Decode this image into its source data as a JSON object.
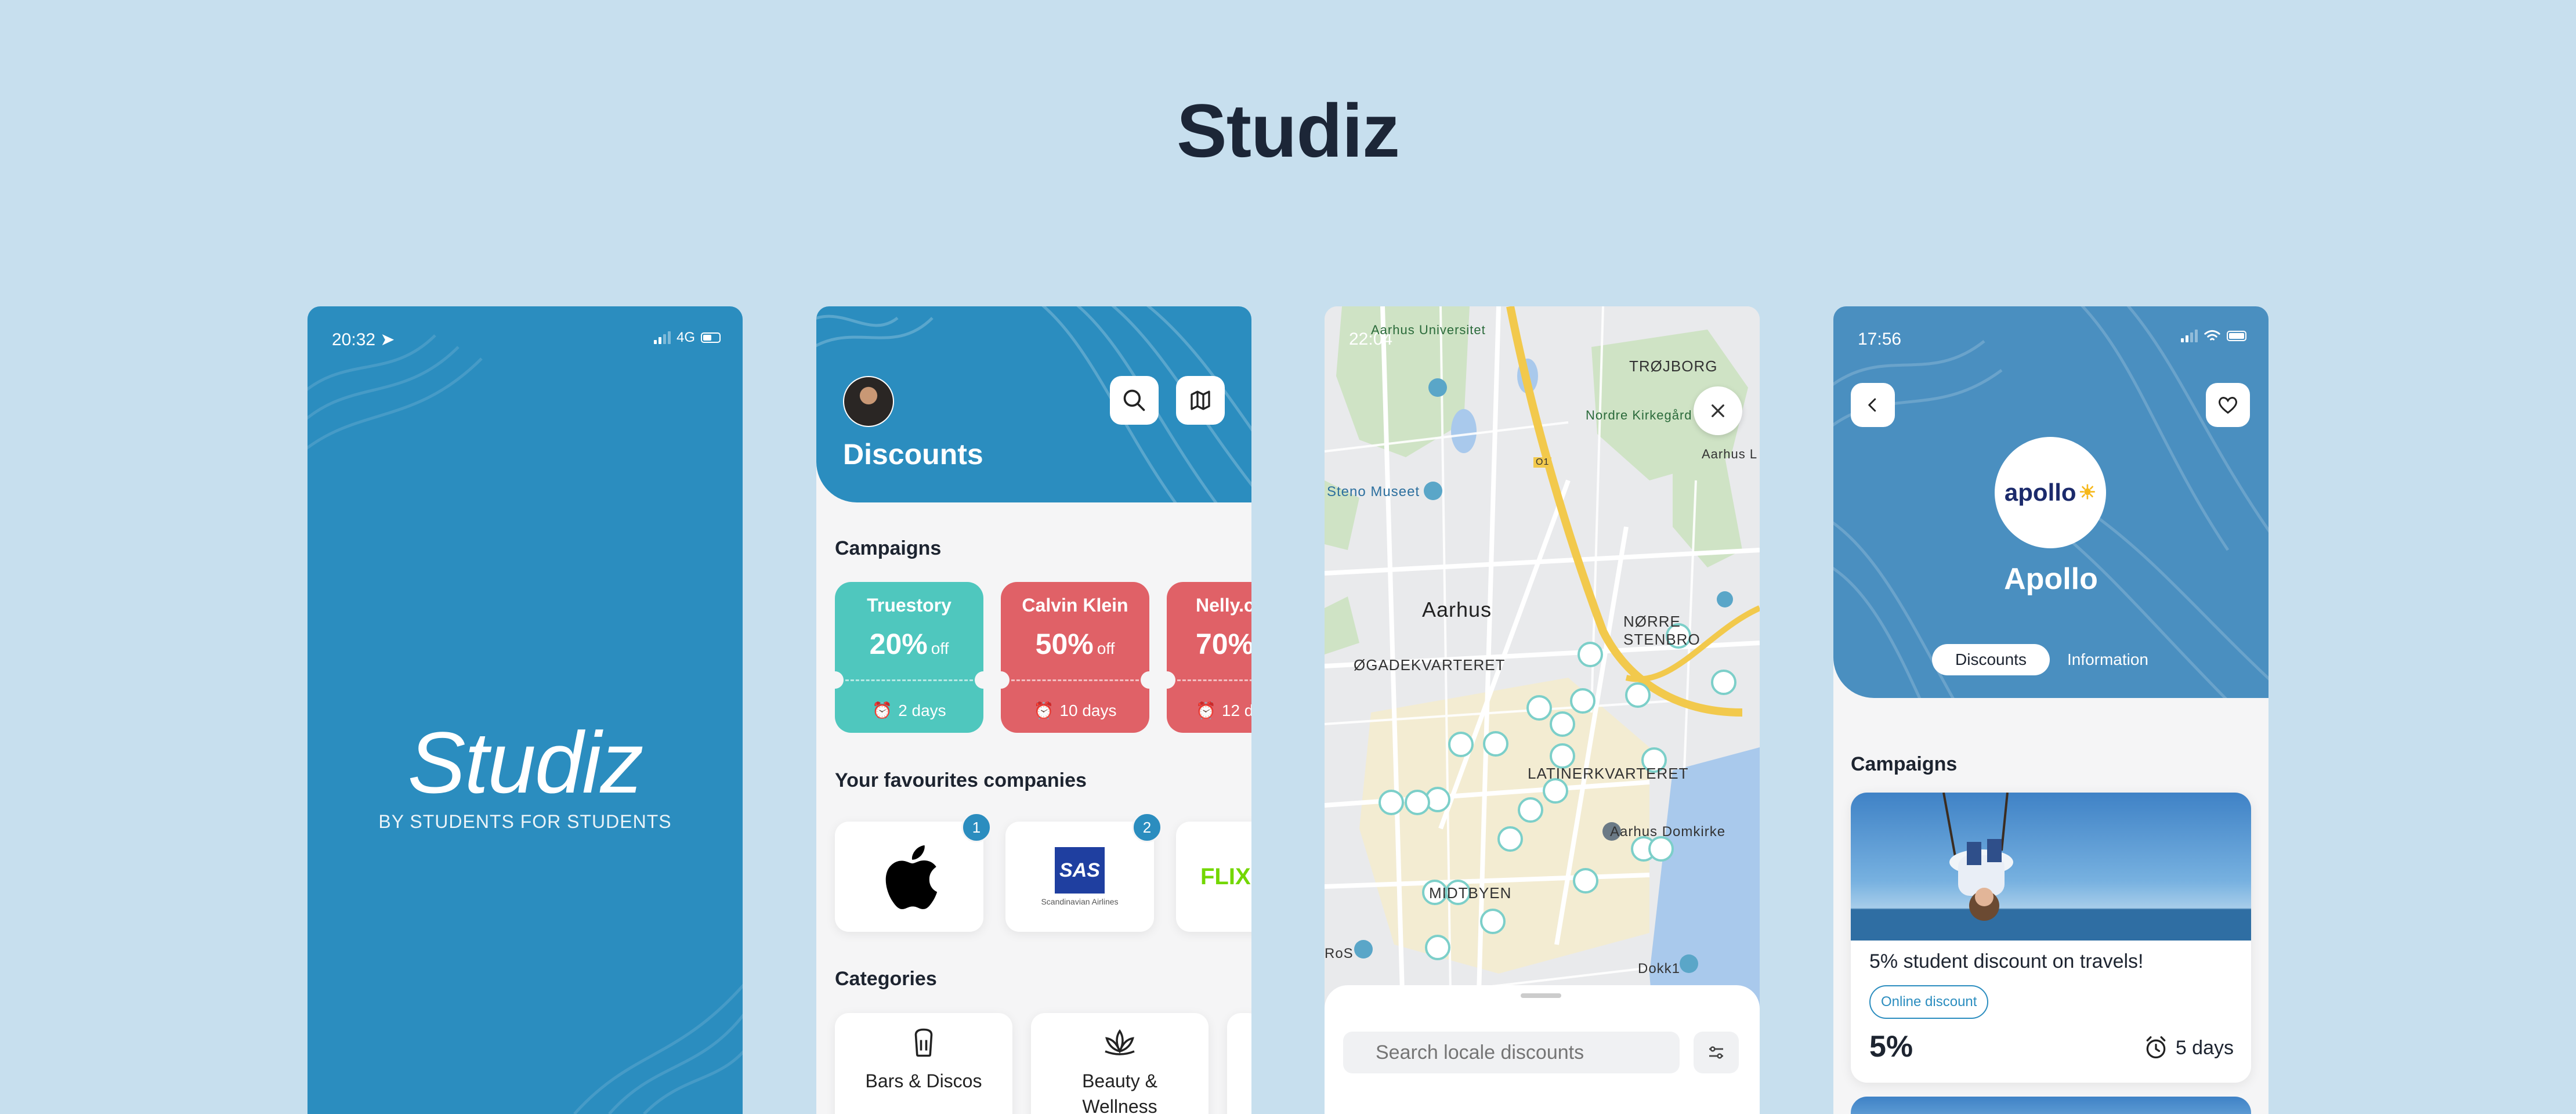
{
  "title": "Studiz",
  "colors": {
    "brand_blue": "#2b8dbf",
    "teal": "#4fc7be",
    "red": "#e06167",
    "background": "#c7dfee"
  },
  "splash": {
    "time": "20:32",
    "network": "4G",
    "logo": "Studiz",
    "tagline": "BY STUDENTS FOR STUDENTS"
  },
  "discounts_screen": {
    "title": "Discounts",
    "campaigns_title": "Campaigns",
    "campaigns": [
      {
        "name": "Truestory",
        "percent": "20%",
        "suffix": "off",
        "days": "2 days",
        "color": "#4fc7be"
      },
      {
        "name": "Calvin Klein",
        "percent": "50%",
        "suffix": "off",
        "days": "10 days",
        "color": "#e06167"
      },
      {
        "name": "Nelly.c",
        "percent": "70%",
        "suffix": "",
        "days": "12 d",
        "color": "#e06167"
      }
    ],
    "favourites_title": "Your favourites companies",
    "favourites": [
      {
        "name": "apple-logo",
        "badge": "1"
      },
      {
        "name": "SAS",
        "sub": "Scandinavian Airlines",
        "badge": "2"
      },
      {
        "name": "FLIX",
        "badge": ""
      }
    ],
    "categories_title": "Categories",
    "categories": [
      {
        "label": "Bars & Discos"
      },
      {
        "label": "Beauty & Wellness"
      }
    ]
  },
  "map_screen": {
    "time": "22:04",
    "labels": {
      "aarhus_uni": "Aarhus Universitet",
      "trojborg": "TRØJBORG",
      "nordre": "Nordre Kirkegård",
      "aarhus_l": "Aarhus L",
      "steno": "Steno Museet",
      "city": "Aarhus",
      "norre": "NØRRE STENBRO",
      "ogade": "ØGADEKVARTERET",
      "latiner": "LATINERKVARTERET",
      "domkirke": "Aarhus Domkirke",
      "midtbyen": "MIDTBYEN",
      "ros": "RoS",
      "dokk": "Dokk1",
      "road": "O1"
    },
    "search_placeholder": "Search locale discounts"
  },
  "company_screen": {
    "time": "17:56",
    "brand_logo": "apollo",
    "brand_name": "Apollo",
    "tabs": [
      "Discounts",
      "Information"
    ],
    "campaigns_title": "Campaigns",
    "offer": {
      "title": "5% student discount on travels!",
      "chip": "Online discount",
      "percent": "5%",
      "days": "5 days"
    }
  }
}
